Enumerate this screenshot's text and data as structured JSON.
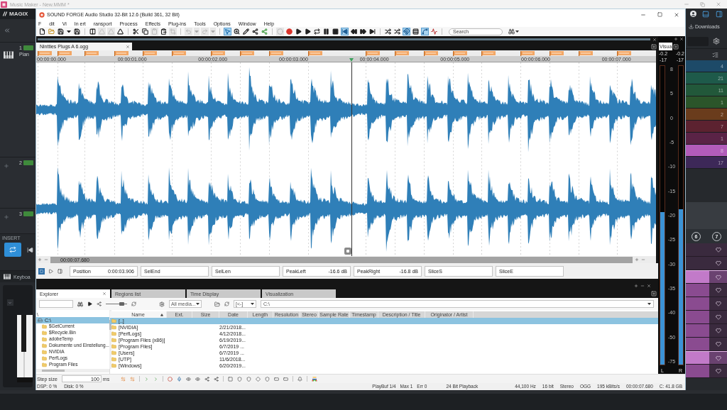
{
  "host_window": {
    "title": "Music Maker - New.MMM *"
  },
  "host_left": {
    "logo": "MAGIX",
    "tracks": [
      {
        "number": "1",
        "kind": "instrument",
        "name": "Pian"
      },
      {
        "number": "2",
        "kind": "empty"
      },
      {
        "number": "3",
        "kind": "empty"
      }
    ],
    "insert_label": "INSERT",
    "keyboard_label": "Keyboa"
  },
  "host_right": {
    "downloads": "Downloads",
    "counts": [
      {
        "value": "4",
        "color": "#1d4a68"
      },
      {
        "value": "21",
        "color": "#1e5a4a"
      },
      {
        "value": "11",
        "color": "#22583a"
      },
      {
        "value": "1",
        "color": "#2b552a"
      },
      {
        "value": "2",
        "color": "#6a3c1c"
      },
      {
        "value": "7",
        "color": "#5c2230"
      },
      {
        "value": "1",
        "color": "#5a2346"
      },
      {
        "value": "8",
        "color": "#b25cba"
      },
      {
        "value": "17",
        "color": "#3d2858"
      }
    ],
    "badges": [
      "6",
      "7"
    ],
    "slots": [
      {
        "clip": false,
        "selected": false
      },
      {
        "clip": false,
        "selected": false
      },
      {
        "clip": true,
        "selected": true
      },
      {
        "clip": true,
        "selected": false
      },
      {
        "clip": true,
        "selected": false
      },
      {
        "clip": true,
        "selected": false
      },
      {
        "clip": true,
        "selected": false
      },
      {
        "clip": true,
        "selected": false
      },
      {
        "clip": true,
        "selected": true
      },
      {
        "clip": true,
        "selected": false
      }
    ]
  },
  "window": {
    "title": "SOUND FORGE Audio Studio 32-Bit 12.6 (Build 361, 32 Bit)"
  },
  "menu": [
    "F",
    "dit",
    "Vi",
    "In ert",
    "ransport",
    "Process",
    "Effects",
    "Plug-ins",
    "Tools",
    "Options",
    "Window",
    "Help"
  ],
  "toolbar": {
    "buttons": [
      {
        "on": false,
        "disabled": false
      },
      {
        "on": false,
        "disabled": false
      },
      {
        "on": false,
        "disabled": false
      },
      {
        "on": false,
        "disabled": false
      },
      {
        "on": false,
        "disabled": false
      },
      {
        "on": false,
        "disabled": false
      },
      {
        "on": false,
        "disabled": true
      },
      {
        "on": false,
        "disabled": true
      },
      {
        "on": false,
        "disabled": false
      },
      {
        "on": false,
        "disabled": false
      },
      {
        "on": false,
        "disabled": false
      },
      {
        "on": false,
        "disabled": true
      },
      {
        "on": false,
        "disabled": false
      },
      {
        "on": false,
        "disabled": true
      },
      {
        "on": false,
        "disabled": true
      },
      {
        "on": false,
        "disabled": true
      },
      {
        "on": false,
        "disabled": true
      },
      {
        "on": false,
        "disabled": true
      },
      {
        "on": true,
        "disabled": false
      },
      {
        "on": false,
        "disabled": false
      },
      {
        "on": false,
        "disabled": false
      },
      {
        "on": false,
        "disabled": false
      },
      {
        "on": false,
        "disabled": false
      },
      {
        "on": false,
        "disabled": true
      },
      {
        "on": false,
        "disabled": false
      },
      {
        "on": false,
        "disabled": false
      },
      {
        "on": false,
        "disabled": false
      },
      {
        "on": false,
        "disabled": false
      },
      {
        "on": false,
        "disabled": false
      },
      {
        "on": false,
        "disabled": false
      },
      {
        "on": true,
        "disabled": false
      },
      {
        "on": false,
        "disabled": false
      },
      {
        "on": false,
        "disabled": false
      },
      {
        "on": false,
        "disabled": false
      },
      {
        "on": false,
        "disabled": false
      },
      {
        "on": false,
        "disabled": false
      },
      {
        "on": true,
        "disabled": false
      },
      {
        "on": false,
        "disabled": false
      },
      {
        "on": true,
        "disabled": false
      },
      {
        "on": false,
        "disabled": false
      }
    ],
    "search": {
      "placeholder": "Search"
    }
  },
  "document": {
    "tab": "Nintties Plugs A 6.ogg",
    "ruler": [
      "00:00:00.000",
      "00:00:01.000",
      "00:00:02.000",
      "00:00:03.000",
      "00:00:04.000",
      "00:00:05.000",
      "00:00:06.000",
      "00:00:07.000"
    ],
    "cursor": {
      "level": 0.5086
    },
    "scroll_label": "00:00:07.680"
  },
  "readouts": [
    {
      "label": "Position",
      "value": "0:00:03.906"
    },
    {
      "label": "SelEnd"
    },
    {
      "label": "SelLen"
    },
    {
      "label": "PeakLeft",
      "value": "-16.6 dB"
    },
    {
      "label": "PeakRight",
      "value": "-16.8 dB"
    },
    {
      "label": "SliceS"
    },
    {
      "label": "SliceE"
    }
  ],
  "meters": {
    "tab": "Visua",
    "peaks": [
      "-0.2",
      "-0.2"
    ],
    "holds": [
      "-17",
      "-17"
    ],
    "scale": [
      "8",
      "5",
      "0",
      "-5",
      "-10",
      "-15",
      "-20",
      "-25",
      "-30",
      "-35",
      "-40",
      "-50",
      "-75"
    ],
    "channels": [
      {
        "name": "L",
        "level": 0.51
      },
      {
        "name": "R",
        "level": 0.52
      }
    ]
  },
  "dock": {
    "tabs": [
      {
        "label": "Explorer",
        "selected": true
      },
      {
        "label": "Regions list",
        "selected": false
      },
      {
        "label": "Time Display",
        "selected": false
      },
      {
        "label": "Visualization",
        "selected": false
      }
    ]
  },
  "explorer": {
    "volume": {
      "level": 0.75
    },
    "filter": "All media...",
    "history": "[<-]",
    "path": "C:\\",
    "tree": {
      "header": "\\",
      "items": [
        {
          "label": "C:\\",
          "selected": true,
          "children": [
            {
              "label": "$GetCurrent",
              "selected": false
            },
            {
              "label": "$Recycle.Bin",
              "selected": false
            },
            {
              "label": "adobeTemp",
              "selected": false
            },
            {
              "label": "Dokumente und Einstellung...",
              "selected": false
            },
            {
              "label": "NVIDIA",
              "selected": false
            },
            {
              "label": "PerfLogs",
              "selected": false
            },
            {
              "label": "Program Files",
              "selected": false
            }
          ]
        }
      ]
    },
    "columns": [
      {
        "label": "Name",
        "sorted": true
      },
      {
        "label": "Ext.",
        "sorted": false
      },
      {
        "label": "Size",
        "sorted": false
      },
      {
        "label": "Date",
        "sorted": false
      },
      {
        "label": "Length",
        "sorted": false
      },
      {
        "label": "Resolution",
        "sorted": false
      },
      {
        "label": "Stereo",
        "sorted": false
      },
      {
        "label": "Sample Rate",
        "sorted": false
      },
      {
        "label": "Timestamp",
        "sorted": false
      },
      {
        "label": "Description / Title",
        "sorted": false
      },
      {
        "label": "Originator / Artist",
        "sorted": false
      }
    ],
    "rows": [
      {
        "name": "[..]",
        "selected": true
      },
      {
        "name": "[NVIDIA]",
        "date": "2/21/2018...",
        "selected": false
      },
      {
        "name": "[PerfLogs]",
        "date": "4/12/2018...",
        "selected": false
      },
      {
        "name": "[Program Files (x86)]",
        "date": "6/19/2019...",
        "selected": false
      },
      {
        "name": "[Program Files]",
        "date": "6/7/2019 ...",
        "selected": false
      },
      {
        "name": "[Users]",
        "date": "6/7/2019 ...",
        "selected": false
      },
      {
        "name": "[UTP]",
        "date": "11/6/2018...",
        "selected": false
      },
      {
        "name": "[Windows]",
        "date": "6/20/2019...",
        "selected": false
      }
    ]
  },
  "step": {
    "label": "Step size",
    "value": "100",
    "unit": "ms"
  },
  "status_bar": {
    "left": [
      "DSP: 0 %",
      "Disk: 0 %"
    ],
    "buffer": [
      "PlayBuf 1/4",
      "Max 1",
      "Err 0"
    ],
    "playback": "24 Bit Playback",
    "format": [
      "44,100 Hz",
      "16 bit",
      "Stereo",
      "OGG",
      "195 kBits/s",
      "00:00:07.680",
      "C: 41.8 GB"
    ]
  }
}
